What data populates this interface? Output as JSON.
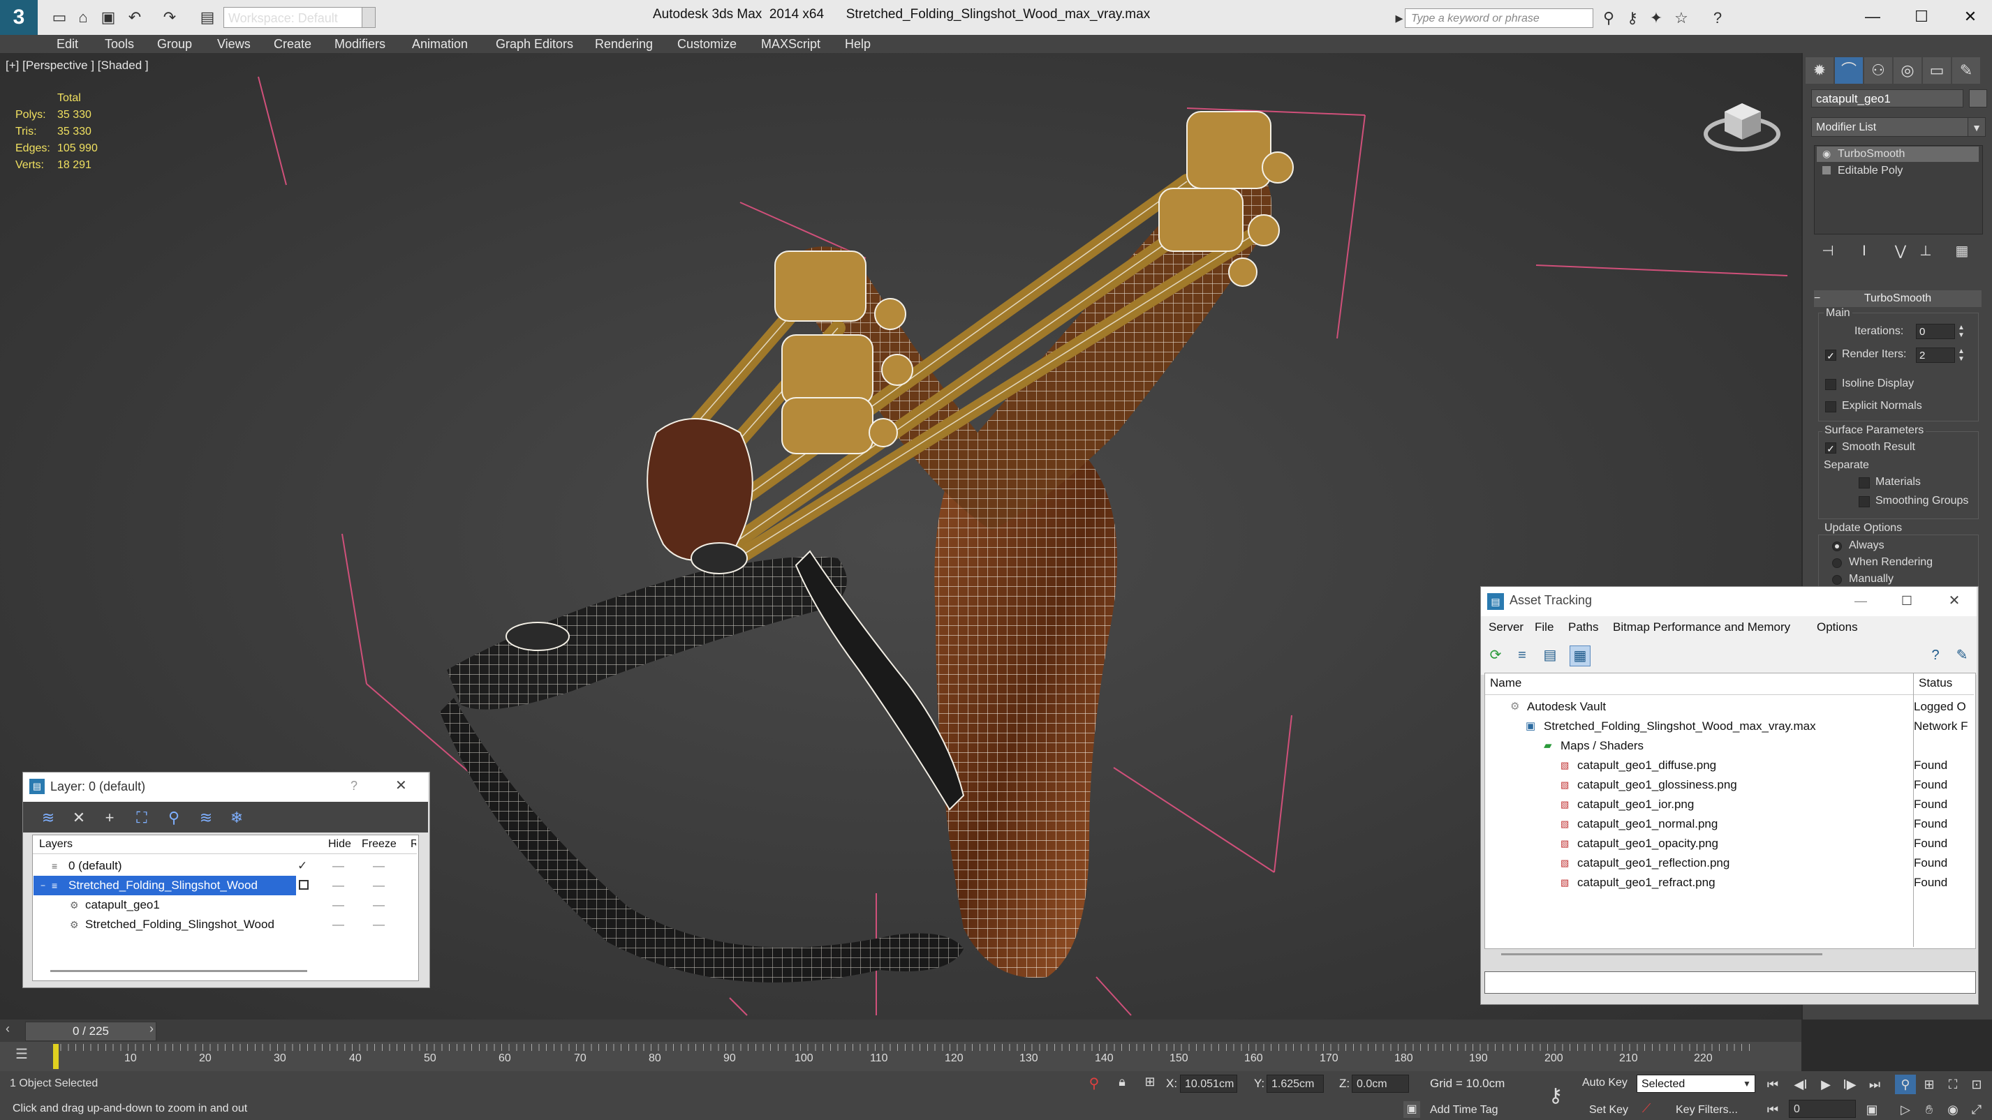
{
  "titlebar": {
    "workspace": "Workspace: Default",
    "title": "Autodesk 3ds Max  2014 x64      Stretched_Folding_Slingshot_Wood_max_vray.max",
    "search_placeholder": "Type a keyword or phrase"
  },
  "menu": [
    "Edit",
    "Tools",
    "Group",
    "Views",
    "Create",
    "Modifiers",
    "Animation",
    "Graph Editors",
    "Rendering",
    "Customize",
    "MAXScript",
    "Help"
  ],
  "viewport": {
    "label": "[+] [Perspective ] [Shaded ]",
    "stats_header": "Total",
    "stats": [
      {
        "label": "Polys:",
        "value": "35 330"
      },
      {
        "label": "Tris:",
        "value": "35 330"
      },
      {
        "label": "Edges:",
        "value": "105 990"
      },
      {
        "label": "Verts:",
        "value": "18 291"
      }
    ]
  },
  "command_panel": {
    "object_name": "catapult_geo1",
    "modifier_list": "Modifier List",
    "stack": [
      "TurboSmooth",
      "Editable Poly"
    ],
    "rollout_title": "TurboSmooth",
    "main_label": "Main",
    "iterations_label": "Iterations:",
    "iterations_value": "0",
    "render_iters_label": "Render Iters:",
    "render_iters_value": "2",
    "isoline": "Isoline Display",
    "explicit_normals": "Explicit Normals",
    "surface_params": "Surface Parameters",
    "smooth_result": "Smooth Result",
    "separate": "Separate",
    "materials": "Materials",
    "smoothing_groups": "Smoothing Groups",
    "update_options": "Update Options",
    "always": "Always",
    "when_rendering": "When Rendering",
    "manually": "Manually"
  },
  "asset_tracking": {
    "title": "Asset Tracking",
    "menu": [
      "Server",
      "File",
      "Paths",
      "Bitmap Performance and Memory",
      "Options"
    ],
    "col_name": "Name",
    "col_status": "Status",
    "rows": [
      {
        "name": "Autodesk Vault",
        "status": "Logged O"
      },
      {
        "name": "Stretched_Folding_Slingshot_Wood_max_vray.max",
        "status": "Network F"
      },
      {
        "name": "Maps / Shaders",
        "status": ""
      },
      {
        "name": "catapult_geo1_diffuse.png",
        "status": "Found"
      },
      {
        "name": "catapult_geo1_glossiness.png",
        "status": "Found"
      },
      {
        "name": "catapult_geo1_ior.png",
        "status": "Found"
      },
      {
        "name": "catapult_geo1_normal.png",
        "status": "Found"
      },
      {
        "name": "catapult_geo1_opacity.png",
        "status": "Found"
      },
      {
        "name": "catapult_geo1_reflection.png",
        "status": "Found"
      },
      {
        "name": "catapult_geo1_refract.png",
        "status": "Found"
      }
    ]
  },
  "layer_window": {
    "title": "Layer: 0 (default)",
    "help": "?",
    "col_layers": "Layers",
    "col_hide": "Hide",
    "col_freeze": "Freeze",
    "col_r": "R",
    "rows": [
      "0 (default)",
      "Stretched_Folding_Slingshot_Wood",
      "catapult_geo1",
      "Stretched_Folding_Slingshot_Wood"
    ]
  },
  "timeline": {
    "frame": "0 / 225",
    "ticks": [
      "10",
      "20",
      "30",
      "40",
      "50",
      "60",
      "70",
      "80",
      "90",
      "100",
      "110",
      "120",
      "130",
      "140",
      "150",
      "160",
      "170",
      "180",
      "190",
      "200",
      "210",
      "220"
    ],
    "progress": 0
  },
  "statusbar": {
    "selected": "1 Object Selected",
    "hint": "Click and drag up-and-down to zoom in and out",
    "x_label": "X:",
    "x_value": "10.051cm",
    "y_label": "Y:",
    "y_value": "1.625cm",
    "z_label": "Z:",
    "z_value": "0.0cm",
    "grid": "Grid = 10.0cm",
    "add_time_tag": "Add Time Tag",
    "auto_key": "Auto Key",
    "set_key": "Set Key",
    "selected_dropdown": "Selected",
    "key_filters": "Key Filters...",
    "frame_field": "0"
  }
}
